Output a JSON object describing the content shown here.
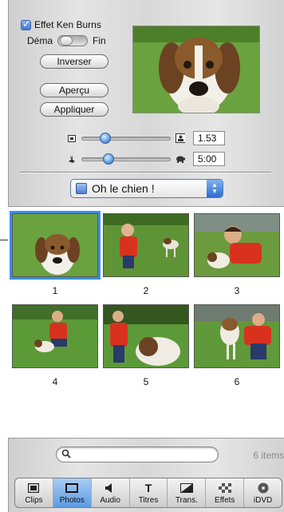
{
  "ken_burns": {
    "checkbox_label": "Effet Ken Burns",
    "checked": true,
    "toggle_start_label": "Déma",
    "toggle_end_label": "Fin"
  },
  "buttons": {
    "reverse_label": "Inverser",
    "preview_label": "Aperçu",
    "apply_label": "Appliquer"
  },
  "sliders": {
    "zoom_value": "1.53",
    "duration_value": "5:00"
  },
  "album": {
    "selected": "Oh le chien !"
  },
  "photos": [
    {
      "caption": "1",
      "selected": true
    },
    {
      "caption": "2",
      "selected": false
    },
    {
      "caption": "3",
      "selected": false
    },
    {
      "caption": "4",
      "selected": false
    },
    {
      "caption": "5",
      "selected": false
    },
    {
      "caption": "6",
      "selected": false
    }
  ],
  "search": {
    "placeholder": "",
    "count_label": "6 items"
  },
  "tabs": [
    {
      "label": "Clips",
      "icon": "clips-icon",
      "active": false
    },
    {
      "label": "Photos",
      "icon": "photos-icon",
      "active": true
    },
    {
      "label": "Audio",
      "icon": "audio-icon",
      "active": false
    },
    {
      "label": "Titres",
      "icon": "titles-icon",
      "active": false
    },
    {
      "label": "Trans.",
      "icon": "transitions-icon",
      "active": false
    },
    {
      "label": "Effets",
      "icon": "effects-icon",
      "active": false
    },
    {
      "label": "iDVD",
      "icon": "idvd-icon",
      "active": false
    }
  ],
  "colors": {
    "accent": "#3b8df0",
    "active_tab": "#5d9be3"
  }
}
